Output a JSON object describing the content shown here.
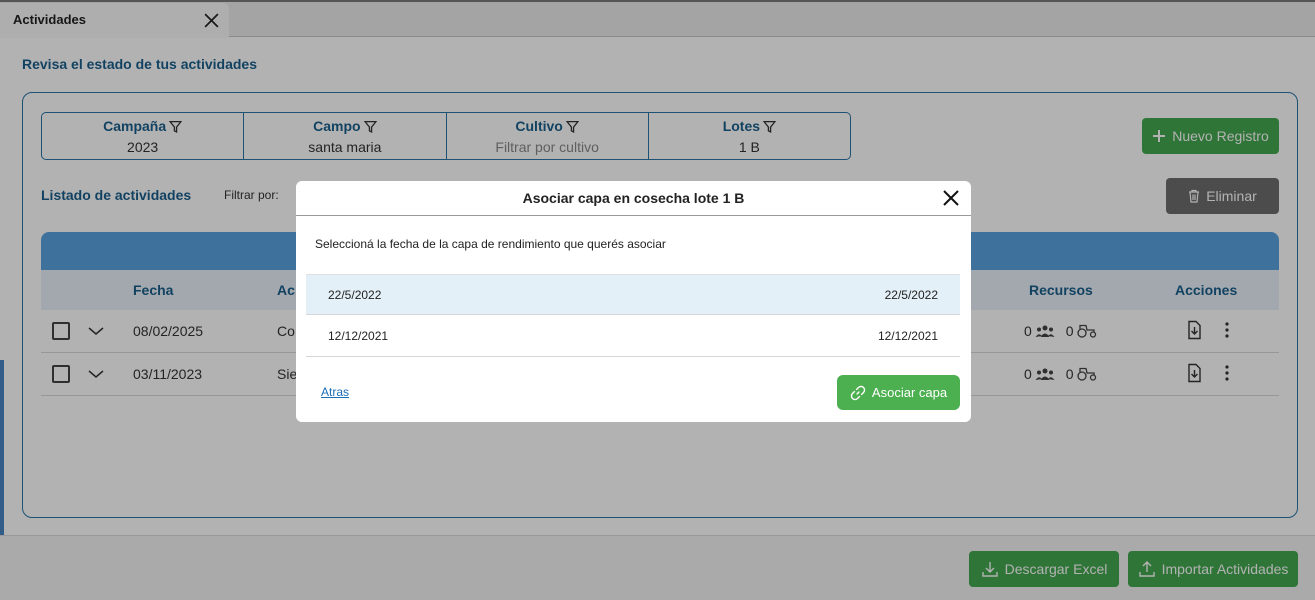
{
  "tab": {
    "title": "Actividades"
  },
  "page": {
    "heading": "Revisa el estado de tus actividades"
  },
  "filters": [
    {
      "label": "Campaña",
      "value": "2023",
      "placeholder": false
    },
    {
      "label": "Campo",
      "value": "santa maria",
      "placeholder": false
    },
    {
      "label": "Cultivo",
      "value": "Filtrar por cultivo",
      "placeholder": true
    },
    {
      "label": "Lotes",
      "value": "1 B",
      "placeholder": false
    }
  ],
  "buttons": {
    "new_record": "Nuevo Registro",
    "delete": "Eliminar",
    "download_excel": "Descargar Excel",
    "import_activities": "Importar Actividades"
  },
  "list": {
    "title": "Listado de actividades",
    "filter_by": "Filtrar por:"
  },
  "table": {
    "headers": {
      "date": "Fecha",
      "activity": "Ac",
      "resources": "Recursos",
      "actions": "Acciones"
    },
    "rows": [
      {
        "date": "08/02/2025",
        "activity": "Co",
        "people": "0",
        "machines": "0"
      },
      {
        "date": "03/11/2023",
        "activity": "Sie",
        "people": "0",
        "machines": "0"
      }
    ]
  },
  "modal": {
    "title": "Asociar capa en cosecha lote 1 B",
    "instruction": "Seleccioná la fecha de la capa de rendimiento que querés asociar",
    "options": [
      {
        "left": "22/5/2022",
        "right": "22/5/2022",
        "selected": true
      },
      {
        "left": "12/12/2021",
        "right": "12/12/2021",
        "selected": false
      }
    ],
    "back": "Atras",
    "confirm": "Asociar capa"
  },
  "colors": {
    "primary_blue": "#1b5f8c",
    "table_header": "#5aa3df",
    "green": "#43a84f",
    "grey_button": "#6d6d6d",
    "selected_row": "#e3f0f8"
  }
}
